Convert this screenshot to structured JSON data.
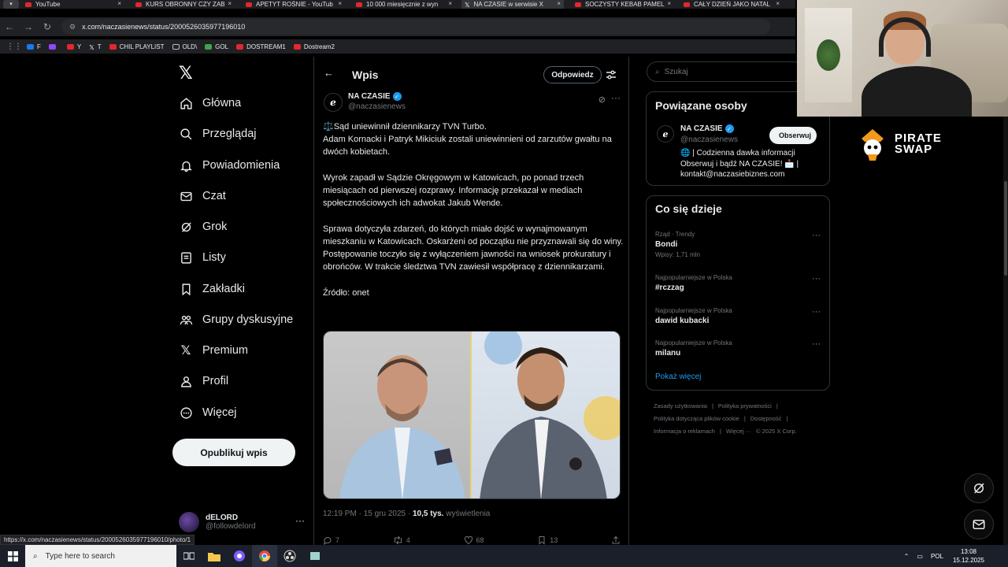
{
  "browser": {
    "tabs": [
      {
        "title": "YouTube",
        "icon": "youtube-icon"
      },
      {
        "title": "KURS OBRONNY CZY ZAB",
        "icon": "youtube-icon"
      },
      {
        "title": "APETYT ROŚNIE - YouTub",
        "icon": "youtube-icon"
      },
      {
        "title": "10 000 miesięcznie z wyn",
        "icon": "youtube-icon"
      },
      {
        "title": "NA CZASIE w serwisie X",
        "icon": "x-icon"
      },
      {
        "title": "SOCZYSTY KEBAB PAMEL",
        "icon": "youtube-icon"
      },
      {
        "title": "CAŁY DZIEŃ JAKO NATAL",
        "icon": "youtube-icon"
      }
    ],
    "close_glyph": "×",
    "url": "x.com/naczasienews/status/2000526035977196010",
    "bookmarks": [
      {
        "label": "F",
        "color": "#1877f2"
      },
      {
        "label": "",
        "color": "#9146ff"
      },
      {
        "label": "Y",
        "color": "#e6262e"
      },
      {
        "label": "T",
        "color": "#ffffff"
      },
      {
        "label": "CHIL PLAYLIST",
        "color": "#e6262e"
      },
      {
        "label": "OLD\\",
        "color": "#bbbbbb"
      },
      {
        "label": "GOL",
        "color": "#3fa34d"
      },
      {
        "label": "DOSTREAM1",
        "color": "#e6262e"
      },
      {
        "label": "Dostream2",
        "color": "#e6262e"
      }
    ],
    "status_url": "https://x.com/naczasienews/status/2000526035977196010/photo/1"
  },
  "nav": {
    "items": [
      {
        "label": "Główna",
        "icon": "home-icon"
      },
      {
        "label": "Przeglądaj",
        "icon": "search-icon"
      },
      {
        "label": "Powiadomienia",
        "icon": "bell-icon"
      },
      {
        "label": "Czat",
        "icon": "mail-icon"
      },
      {
        "label": "Grok",
        "icon": "grok-icon"
      },
      {
        "label": "Listy",
        "icon": "list-icon"
      },
      {
        "label": "Zakładki",
        "icon": "bookmark-icon"
      },
      {
        "label": "Grupy dyskusyjne",
        "icon": "communities-icon"
      },
      {
        "label": "Premium",
        "icon": "x-icon"
      },
      {
        "label": "Profil",
        "icon": "profile-icon"
      },
      {
        "label": "Więcej",
        "icon": "more-icon"
      }
    ],
    "post_button": "Opublikuj wpis",
    "account": {
      "name": "dELORD",
      "handle": "@followdelord"
    }
  },
  "main": {
    "header_title": "Wpis",
    "reply_button": "Odpowiedz",
    "author": {
      "name": "NA CZASIE",
      "handle": "@naczasienews"
    },
    "text": [
      "⚖️Sąd uniewinnił dziennikarzy TVN Turbo.",
      "Adam Kornacki i Patryk Mikiciuk zostali uniewinnieni od zarzutów gwałtu na dwóch kobietach.",
      "",
      "Wyrok zapadł w Sądzie Okręgowym w Katowicach, po ponad trzech miesiącach od pierwszej rozprawy. Informację przekazał w mediach społecznościowych ich adwokat Jakub Wende.",
      "",
      "Sprawa dotyczyła zdarzeń, do których miało dojść w wynajmowanym mieszkaniu w Katowicach. Oskarżeni od początku nie przyznawali się do winy.",
      "Postępowanie toczyło się z wyłączeniem jawności na wniosek prokuratury i obrońców. W trakcie śledztwa TVN zawiesił współpracę z dziennikarzami.",
      "",
      "Źródło: onet"
    ],
    "meta": {
      "time": "12:19 PM · 15 gru 2025 · ",
      "views_count": "10,5 tys.",
      "views_label": " wyświetlenia"
    },
    "actions": [
      {
        "icon": "reply-icon",
        "count": "7"
      },
      {
        "icon": "repost-icon",
        "count": "4"
      },
      {
        "icon": "like-icon",
        "count": "68"
      },
      {
        "icon": "bookmark-icon",
        "count": "13"
      },
      {
        "icon": "share-icon",
        "count": ""
      }
    ]
  },
  "right": {
    "search_placeholder": "Szukaj",
    "related": {
      "title": "Powiązane osoby",
      "name": "NA CZASIE",
      "handle": "@naczasienews",
      "follow": "Obserwuj",
      "bio": "🌐 | Codzienna dawka informacji Obserwuj i bądź NA CZASIE! 📩 | kontakt@naczasiebiznes.com"
    },
    "trends": {
      "title": "Co się dzieje",
      "items": [
        {
          "context": "Rząd · Trendy",
          "name": "Bondi",
          "count": "Wpisy: 1,71 mln"
        },
        {
          "context": "Najpopularniejsze w Polska",
          "name": "#rczzag",
          "count": ""
        },
        {
          "context": "Najpopularniejsze w Polska",
          "name": "dawid kubacki",
          "count": ""
        },
        {
          "context": "Najpopularniejsze w Polska",
          "name": "milanu",
          "count": ""
        }
      ],
      "show_more": "Pokaż więcej"
    },
    "footer": [
      "Zasady użytkowania",
      "|",
      "Polityka prywatności",
      "|",
      "Polityka dotycząca plików cookie",
      "|",
      "Dostępność",
      "|",
      "Informacja o reklamach",
      "|",
      "Więcej ···",
      "© 2025 X Corp."
    ]
  },
  "overlay": {
    "brand_line1": "PIRATE",
    "brand_line2": "SWAP"
  },
  "taskbar": {
    "search_placeholder": "Type here to search",
    "language": "POL",
    "time": "13:08",
    "date": "15.12.2025"
  },
  "colors": {
    "accent": "#1d9bf0",
    "background": "#000000",
    "text": "#e7e9ea",
    "muted": "#71767b"
  }
}
